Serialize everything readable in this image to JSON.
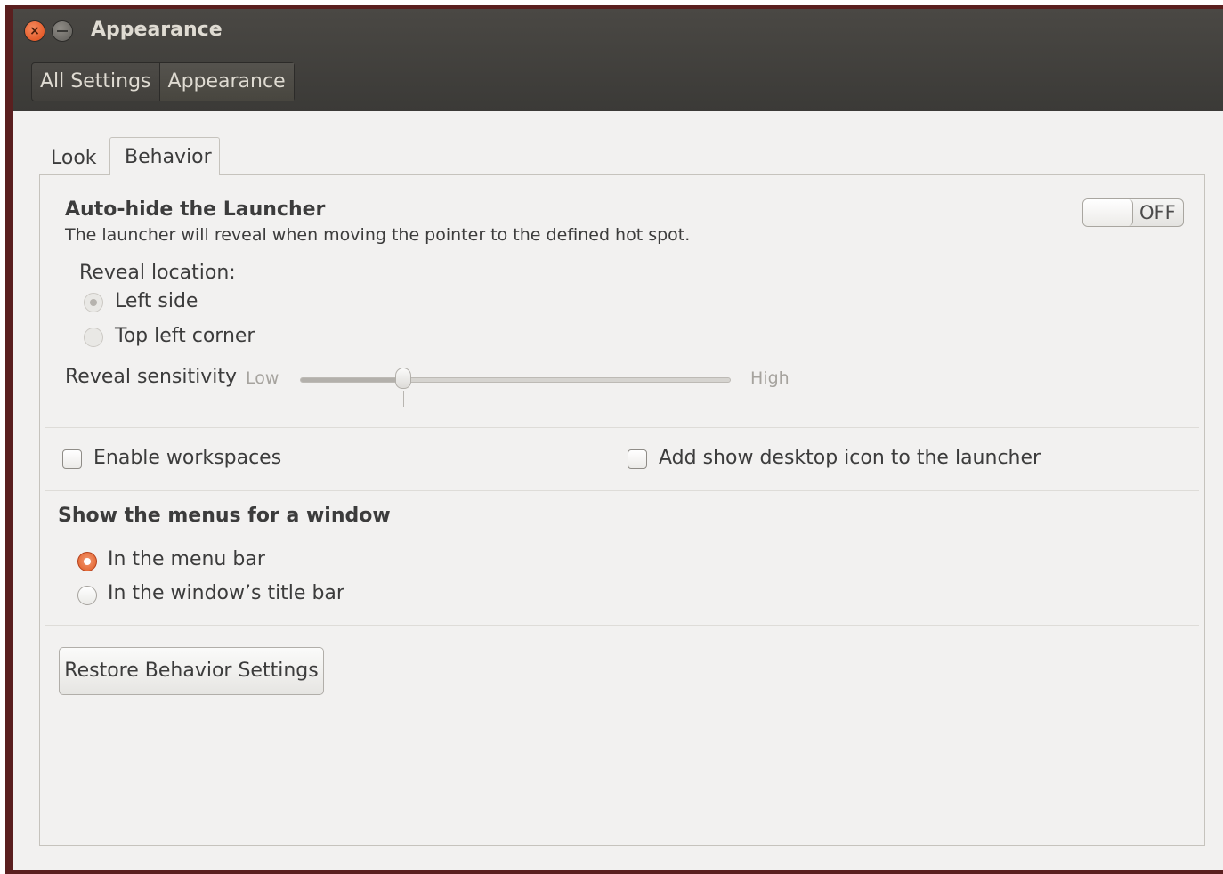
{
  "window": {
    "title": "Appearance",
    "close_icon_glyph": "×"
  },
  "breadcrumb": {
    "items": [
      {
        "label": "All Settings"
      },
      {
        "label": "Appearance"
      }
    ]
  },
  "tabs": [
    {
      "label": "Look",
      "selected": false
    },
    {
      "label": "Behavior",
      "selected": true
    }
  ],
  "autohide": {
    "title": "Auto-hide the Launcher",
    "description": "The launcher will reveal when moving the pointer to the defined hot spot.",
    "toggle_state": "OFF",
    "reveal_location_label": "Reveal location:",
    "reveal_options": [
      {
        "label": "Left side",
        "selected": true,
        "enabled": false
      },
      {
        "label": "Top left corner",
        "selected": false,
        "enabled": false
      }
    ],
    "sensitivity_label": "Reveal sensitivity",
    "sensitivity_low": "Low",
    "sensitivity_high": "High",
    "sensitivity_value": 0.24
  },
  "options": {
    "enable_workspaces": {
      "label": "Enable workspaces",
      "checked": false
    },
    "show_desktop_icon": {
      "label": "Add show desktop icon to the launcher",
      "checked": false
    }
  },
  "menus": {
    "title": "Show the menus for a window",
    "options": [
      {
        "label": "In the menu bar",
        "selected": true
      },
      {
        "label": "In the window’s title bar",
        "selected": false
      }
    ]
  },
  "restore_button": {
    "label": "Restore Behavior Settings"
  },
  "colors": {
    "accent": "#e05a22",
    "titlebar": "#3c3b37",
    "window_bg": "#f2f1f0"
  }
}
